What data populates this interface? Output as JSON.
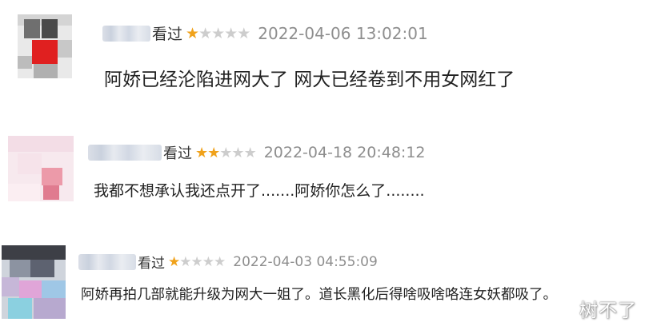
{
  "colors": {
    "star_on": "#f0a21b",
    "star_off": "#cdcdcd",
    "date_text": "#8e8e8e",
    "body_text": "#222222"
  },
  "reviews": [
    {
      "status": "看过",
      "rating": 1,
      "rating_max": 5,
      "datetime": "2022-04-06 13:02:01",
      "comment": "阿娇已经沦陷进网大了 网大已经卷到不用女网红了"
    },
    {
      "status": "看过",
      "rating": 2,
      "rating_max": 5,
      "datetime": "2022-04-18 20:48:12",
      "comment": "我都不想承认我还点开了.......阿娇你怎么了........"
    },
    {
      "status": "看过",
      "rating": 1,
      "rating_max": 5,
      "datetime": "2022-04-03 04:55:09",
      "comment": "阿娇再拍几部就能升级为网大一姐了。道长黑化后得啥吸啥咯连女妖都吸了。"
    }
  ],
  "watermark": "树不了"
}
